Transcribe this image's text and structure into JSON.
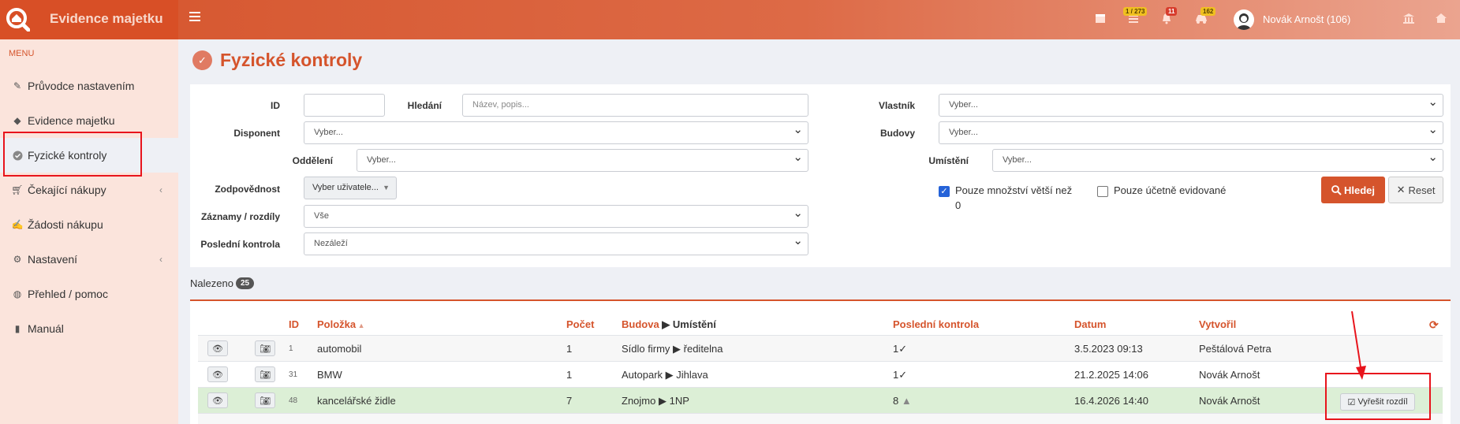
{
  "app": {
    "title": "Evidence majetku"
  },
  "topbar": {
    "tasks_badge": "1 / 273",
    "notifications_badge": "11",
    "cars_badge": "162",
    "user_name": "Novák Arnošt (106)"
  },
  "sidebar": {
    "menu_header": "MENU",
    "items": [
      {
        "label": "Průvodce nastavením",
        "icon": "pencil-icon"
      },
      {
        "label": "Evidence majetku",
        "icon": "diamond-icon"
      },
      {
        "label": "Fyzické kontroly",
        "icon": "check-circle-icon",
        "active": true
      },
      {
        "label": "Čekající nákupy",
        "icon": "cart-icon"
      },
      {
        "label": "Žádosti nákupu",
        "icon": "edit-icon"
      },
      {
        "label": "Nastavení",
        "icon": "gears-icon"
      },
      {
        "label": "Přehled / pomoc",
        "icon": "globe-icon"
      },
      {
        "label": "Manuál",
        "icon": "book-icon"
      }
    ]
  },
  "page": {
    "title": "Fyzické kontroly"
  },
  "filters": {
    "id_label": "ID",
    "id_value": "",
    "search_label": "Hledání",
    "search_placeholder": "Název, popis...",
    "disponent_label": "Disponent",
    "disponent_value": "Vyber...",
    "department_label": "Oddělení",
    "department_value": "Vyber...",
    "responsibility_label": "Zodpovědnost",
    "responsibility_value": "Vyber uživatele...",
    "records_label": "Záznamy / rozdíly",
    "records_value": "Vše",
    "last_check_label": "Poslední kontrola",
    "last_check_value": "Nezáleží",
    "owner_label": "Vlastník",
    "owner_value": "Vyber...",
    "buildings_label": "Budovy",
    "buildings_value": "Vyber...",
    "location_label": "Umístění",
    "location_value": "Vyber...",
    "qty_checkbox_label": "Pouze množství větší než",
    "qty_checkbox_value": "0",
    "accounting_checkbox_label": "Pouze účetně evidované",
    "search_button": "Hledej",
    "reset_button": "Reset"
  },
  "results": {
    "found_label": "Nalezeno",
    "found_count": "25"
  },
  "table": {
    "headers": {
      "id": "ID",
      "item": "Položka",
      "count": "Počet",
      "building": "Budova",
      "location": "Umístění",
      "last_check": "Poslední kontrola",
      "date": "Datum",
      "created_by": "Vytvořil"
    },
    "rows": [
      {
        "id": "1",
        "item": "automobil",
        "count": "1",
        "building": "Sídlo firmy",
        "location": "ředitelna",
        "last_check": "1",
        "status": "ok",
        "date": "3.5.2023 09:13",
        "created_by": "Peštálová Petra"
      },
      {
        "id": "31",
        "item": "BMW",
        "count": "1",
        "building": "Autopark",
        "location": "Jihlava",
        "last_check": "1",
        "status": "ok",
        "date": "21.2.2025 14:06",
        "created_by": "Novák Arnošt"
      },
      {
        "id": "48",
        "item": "kancelářské židle",
        "count": "7",
        "building": "Znojmo",
        "location": "1NP",
        "last_check": "8",
        "status": "warning",
        "date": "16.4.2026 14:40",
        "created_by": "Novák Arnošt",
        "action": "Vyřešit rozdíl"
      }
    ]
  }
}
